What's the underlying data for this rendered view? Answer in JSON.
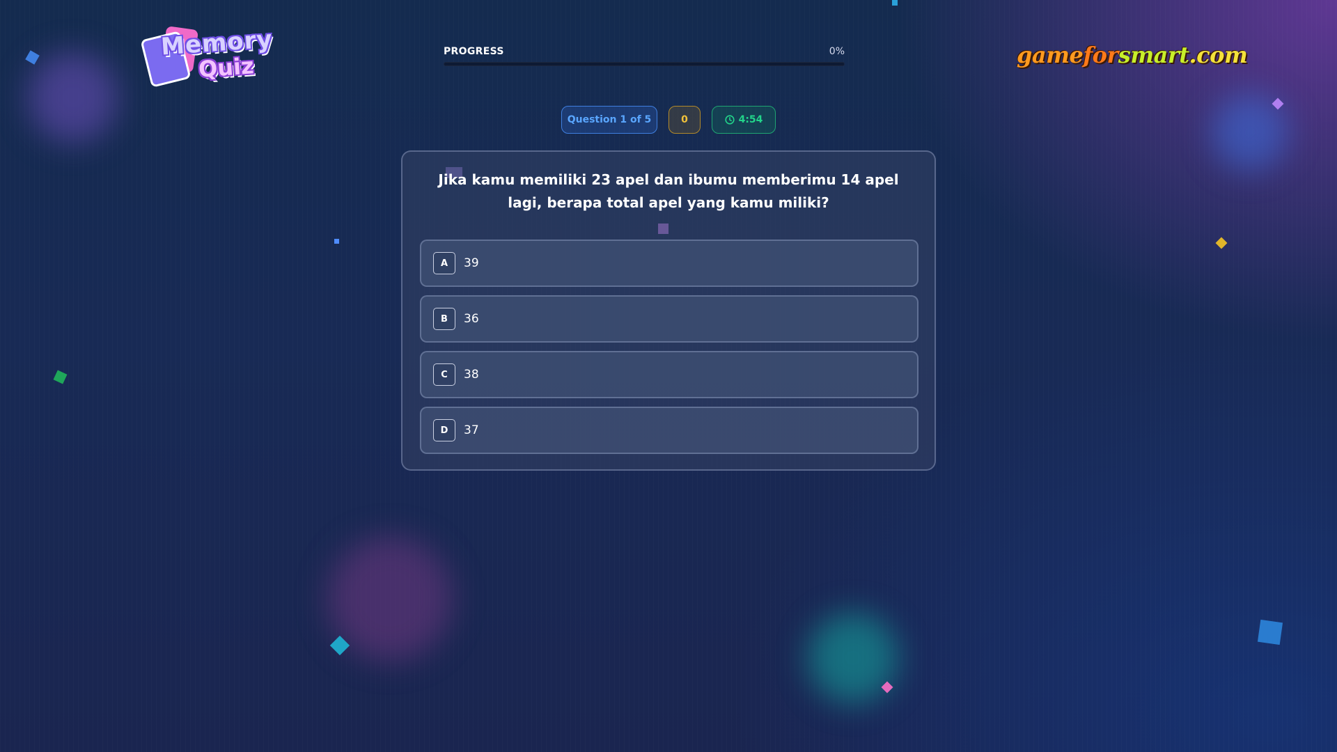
{
  "logo": {
    "word_top": "Memory",
    "word_bottom": "Quiz"
  },
  "progress": {
    "label": "PROGRESS",
    "value_text": "0%",
    "fraction": 0,
    "fill_color": "#4f8cff"
  },
  "brand": {
    "part1": "game",
    "part2": "for",
    "part3": "smart",
    "part4": ".com"
  },
  "status": {
    "question_counter": "Question 1 of 5",
    "score": "0",
    "timer": "4:54",
    "timer_icon": "clock-icon",
    "colors": {
      "question": "#5aa6ff",
      "score": "#f2c23a",
      "timer": "#22d48a"
    }
  },
  "question": {
    "text": "Jika kamu memiliki 23 apel dan ibumu memberimu 14 apel lagi, berapa total apel yang kamu miliki?",
    "options": [
      {
        "key": "A",
        "text": "39"
      },
      {
        "key": "B",
        "text": "36"
      },
      {
        "key": "C",
        "text": "38"
      },
      {
        "key": "D",
        "text": "37"
      }
    ]
  }
}
